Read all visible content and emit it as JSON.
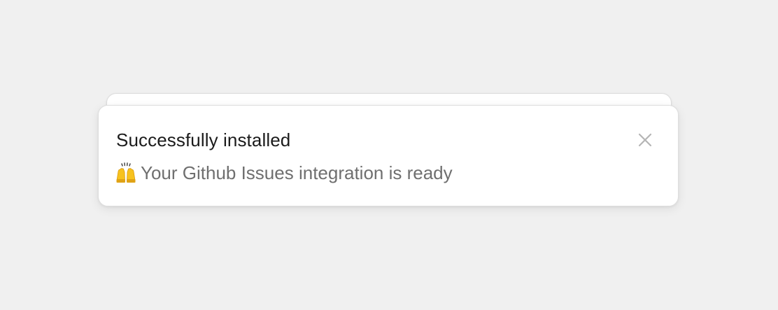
{
  "toast": {
    "title": "Successfully installed",
    "emoji_icon": "raising-hands-emoji",
    "message": "Your Github Issues integration is ready",
    "close_icon": "close-icon"
  },
  "colors": {
    "background": "#f0f0f0",
    "card": "#ffffff",
    "title_text": "#1b1b1b",
    "message_text": "#6f6f6f",
    "close_icon": "#b5b5b5",
    "emoji_yellow": "#f7c21e"
  }
}
